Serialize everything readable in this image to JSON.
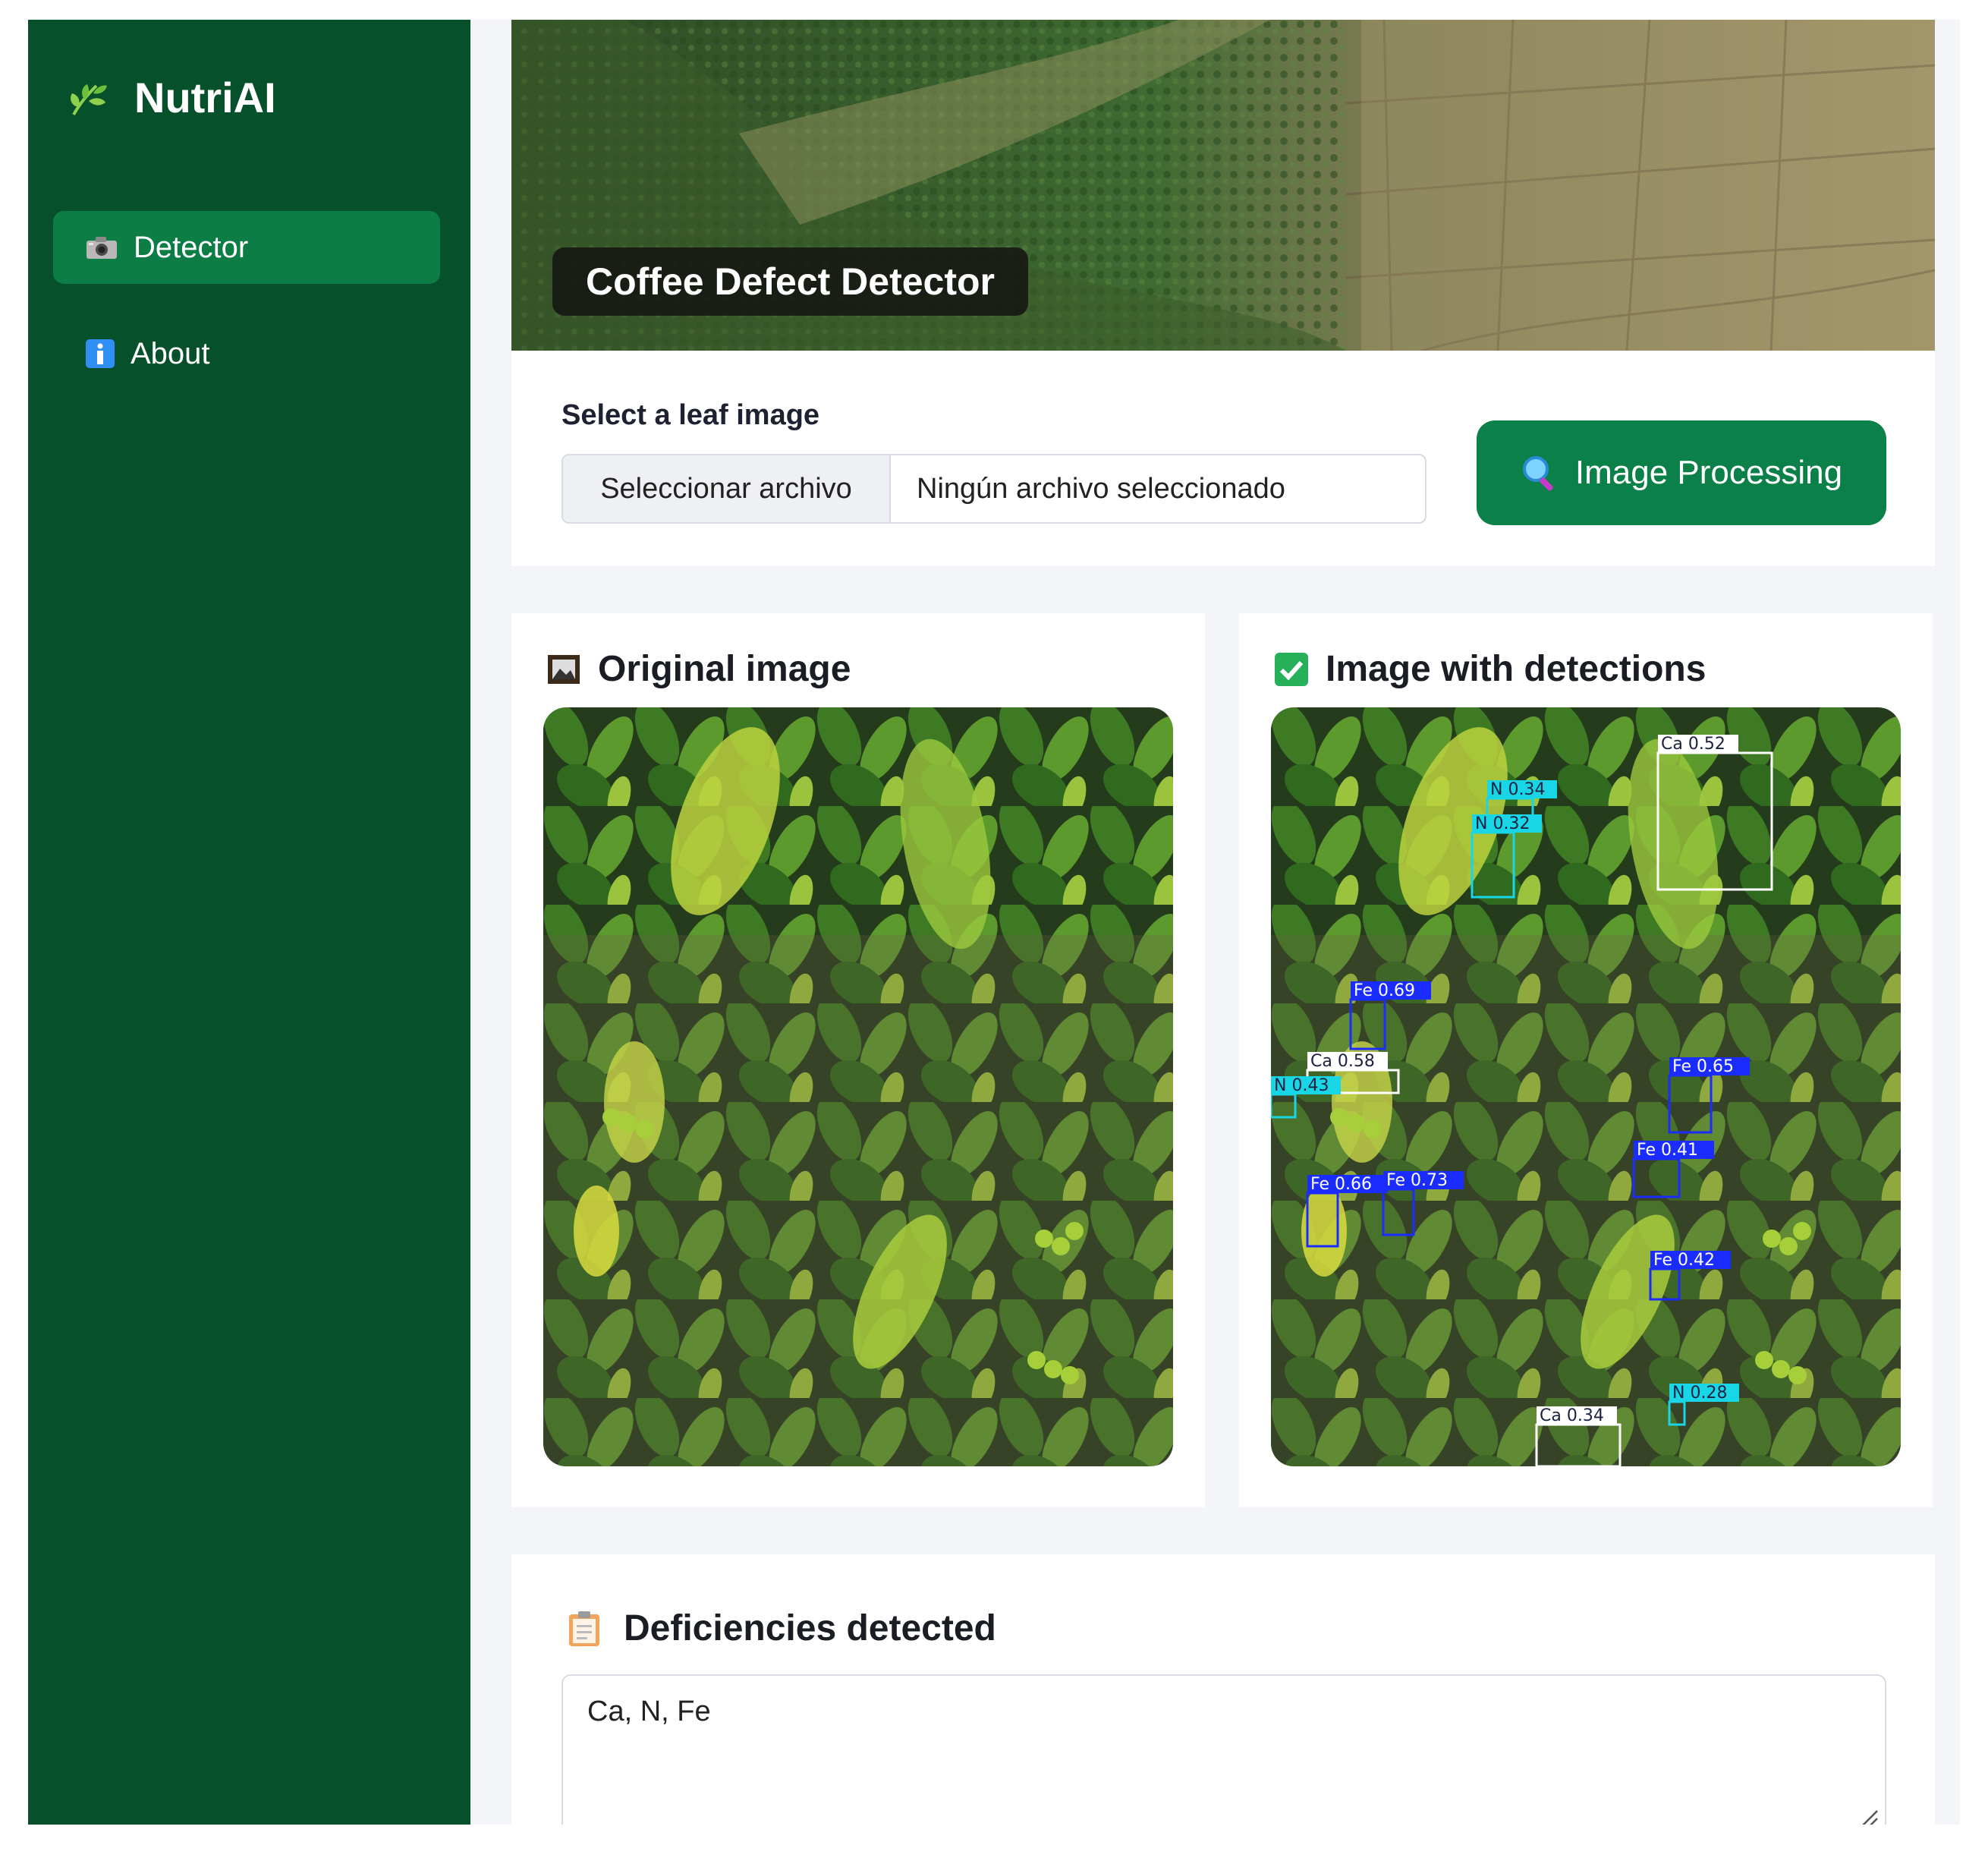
{
  "sidebar": {
    "brand": "NutriAI",
    "items": [
      {
        "label": "Detector",
        "active": true,
        "icon": "camera-icon"
      },
      {
        "label": "About",
        "active": false,
        "icon": "info-icon"
      }
    ]
  },
  "hero": {
    "title": "Coffee Defect Detector"
  },
  "upload": {
    "label": "Select a leaf image",
    "button_label": "Seleccionar archivo",
    "file_status": "Ningún archivo seleccionado",
    "process_label": "Image Processing",
    "process_icon": "magnifier-icon"
  },
  "original": {
    "title": "Original image",
    "icon": "framed-picture-icon"
  },
  "detections": {
    "title": "Image with detections",
    "icon": "check-box-icon",
    "boxes": [
      {
        "label": "Ca 0.52",
        "kind": "Ca"
      },
      {
        "label": "N 0.34",
        "kind": "N"
      },
      {
        "label": "N 0.32",
        "kind": "N"
      },
      {
        "label": "Fe 0.69",
        "kind": "Fe"
      },
      {
        "label": "Ca 0.58",
        "kind": "Ca"
      },
      {
        "label": "N 0.43",
        "kind": "N"
      },
      {
        "label": "Fe 0.65",
        "kind": "Fe"
      },
      {
        "label": "Fe 0.41",
        "kind": "Fe"
      },
      {
        "label": "Fe 0.66",
        "kind": "Fe"
      },
      {
        "label": "Fe 0.73",
        "kind": "Fe"
      },
      {
        "label": "Fe 0.42",
        "kind": "Fe"
      },
      {
        "label": "N 0.28",
        "kind": "N"
      },
      {
        "label": "Ca 0.34",
        "kind": "Ca"
      }
    ]
  },
  "deficiencies": {
    "title": "Deficiencies detected",
    "icon": "clipboard-icon",
    "value": "Ca, N, Fe"
  },
  "colors": {
    "sidebar": "#06512b",
    "accent": "#0b8048",
    "fe_box": "#1a2cff",
    "n_box": "#19d6e6",
    "ca_box": "#ffffff"
  }
}
